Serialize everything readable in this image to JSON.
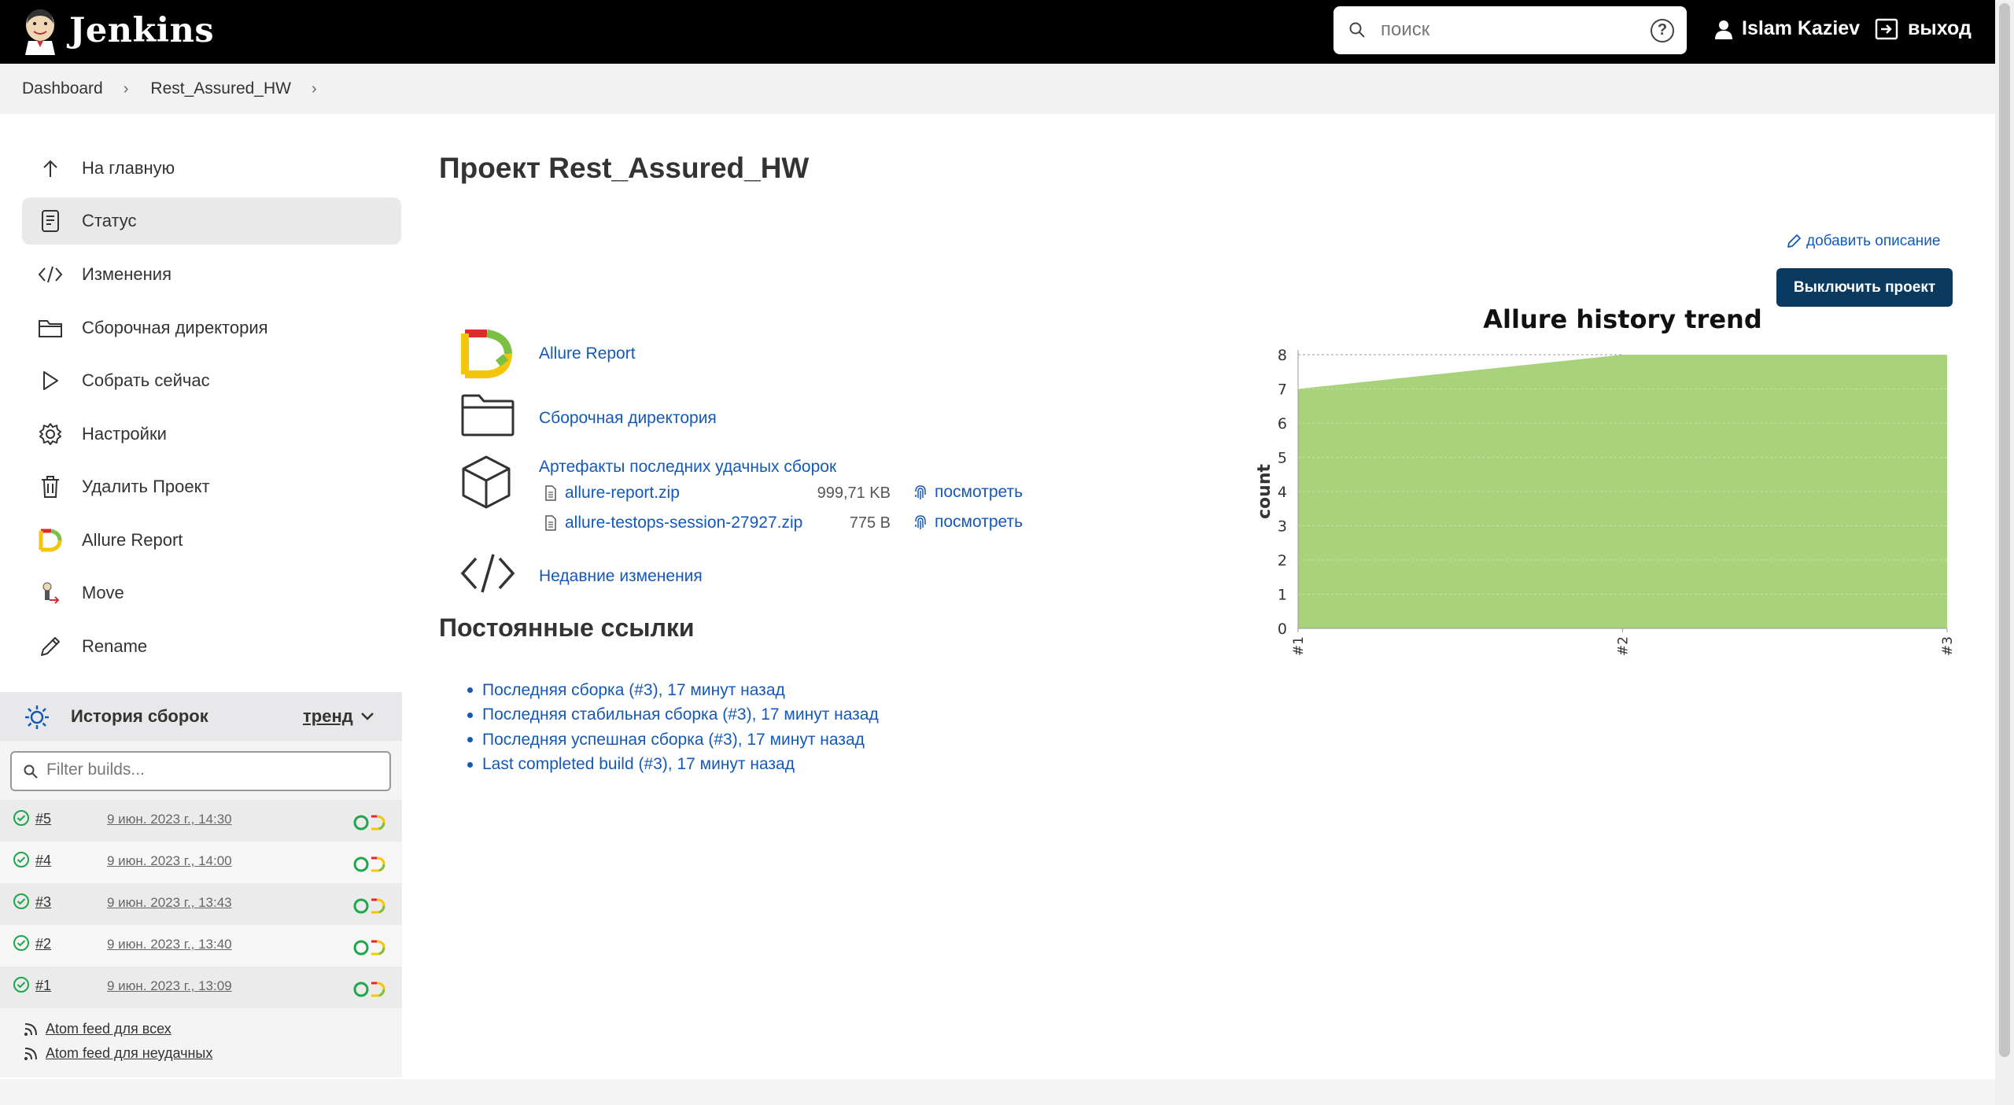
{
  "header": {
    "title": "Jenkins",
    "search_placeholder": "поиск",
    "help": "?",
    "user": "Islam Kaziev",
    "logout": "выход"
  },
  "breadcrumb": [
    "Dashboard",
    "Rest_Assured_HW"
  ],
  "sidebar": {
    "items": [
      {
        "label": "На главную",
        "icon": "arrow-up-icon"
      },
      {
        "label": "Статус",
        "icon": "document-icon"
      },
      {
        "label": "Изменения",
        "icon": "code-icon"
      },
      {
        "label": "Сборочная директория",
        "icon": "folder-icon"
      },
      {
        "label": "Собрать сейчас",
        "icon": "play-icon"
      },
      {
        "label": "Настройки",
        "icon": "gear-icon"
      },
      {
        "label": "Удалить Проект",
        "icon": "trash-icon"
      },
      {
        "label": "Allure Report",
        "icon": "allure-icon"
      },
      {
        "label": "Move",
        "icon": "move-icon"
      },
      {
        "label": "Rename",
        "icon": "pencil-icon"
      }
    ]
  },
  "history": {
    "title": "История сборок",
    "trend": "тренд",
    "filter_placeholder": "Filter builds...",
    "builds": [
      {
        "num": "#5",
        "date": "9 июн. 2023 г., 14:30"
      },
      {
        "num": "#4",
        "date": "9 июн. 2023 г., 14:00"
      },
      {
        "num": "#3",
        "date": "9 июн. 2023 г., 13:43"
      },
      {
        "num": "#2",
        "date": "9 июн. 2023 г., 13:40"
      },
      {
        "num": "#1",
        "date": "9 июн. 2023 г., 13:09"
      }
    ],
    "feed_all": "Atom feed для всех",
    "feed_failed": "Atom feed для неудачных"
  },
  "main": {
    "title": "Проект Rest_Assured_HW",
    "add_description": "добавить описание",
    "disable_button": "Выключить проект",
    "allure_report": "Allure Report",
    "workspace": "Сборочная директория",
    "artifacts_title": "Артефакты последних удачных сборок",
    "artifacts": [
      {
        "name": "allure-report.zip",
        "size": "999,71 KB",
        "view": "посмотреть"
      },
      {
        "name": "allure-testops-session-27927.zip",
        "size": "775 B",
        "view": "посмотреть"
      }
    ],
    "recent_changes": "Недавние изменения",
    "permalinks_title": "Постоянные ссылки",
    "permalinks": [
      "Последняя сборка (#3), 17 минут назад",
      "Последняя стабильная сборка (#3), 17 минут назад",
      "Последняя успешная сборка (#3), 17 минут назад",
      "Last completed build (#3), 17 минут назад"
    ]
  },
  "chart_data": {
    "type": "area",
    "title": "Allure history trend",
    "ylabel": "count",
    "xlabel": "",
    "x": [
      "#1",
      "#2",
      "#3"
    ],
    "series": [
      {
        "values": [
          7,
          8,
          8
        ],
        "color": "#a8d37a"
      }
    ],
    "ylim": [
      0,
      8
    ],
    "yticks": [
      "0",
      "1",
      "2",
      "3",
      "4",
      "5",
      "6",
      "7",
      "8"
    ],
    "grid": true
  },
  "colors": {
    "link": "#1459b8",
    "header_bg": "#000000",
    "button_bg": "#0b3a60",
    "success": "#1ea64b",
    "chart_fill": "#a8d37a"
  }
}
